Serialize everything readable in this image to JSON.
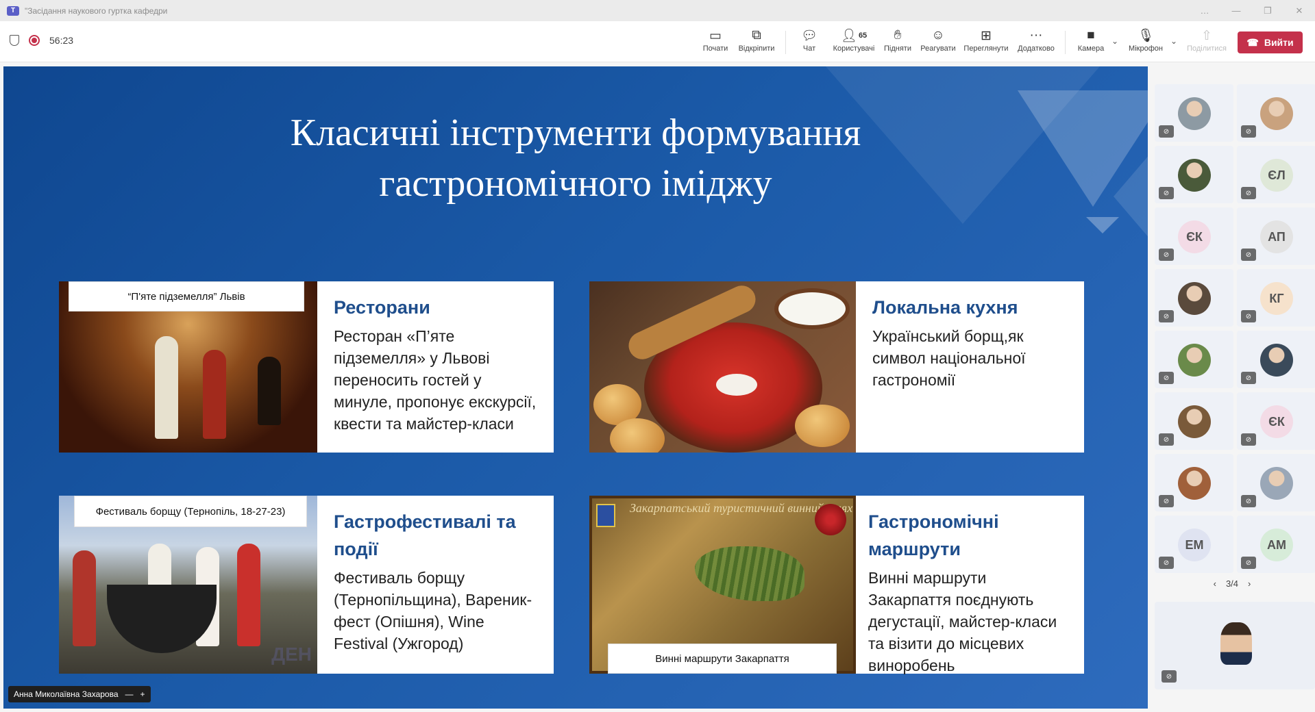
{
  "window": {
    "title": "\"Засідання наукового гуртка кафедри",
    "controls": [
      "…",
      "—",
      "❐",
      "✕"
    ]
  },
  "meeting": {
    "timer": "56:23"
  },
  "toolbar": {
    "start": "Почати",
    "popout": "Відкріпити",
    "chat": "Чат",
    "people": "Користувачі",
    "people_count": "65",
    "raise": "Підняти",
    "react": "Реагувати",
    "view": "Переглянути",
    "more": "Додатково",
    "camera": "Камера",
    "mic": "Мікрофон",
    "share": "Поділитися",
    "leave": "Вийти"
  },
  "slide": {
    "title": "Класичні інструменти формування гастрономічного іміджу",
    "cards": [
      {
        "caption": "“П'яте підземелля” Львів",
        "heading": "Ресторани",
        "body": "Ресторан «П’яте підземелля» у Львові переносить гостей у минуле,  пропонує екскурсії, квести та майстер-класи"
      },
      {
        "caption": "",
        "heading": "Локальна кухня",
        "body": "Український борщ,як символ національної гастрономії"
      },
      {
        "caption": "Фестиваль борщу (Тернопіль, 18-27-23)",
        "heading": "Гастрофестивалі та події",
        "body": "Фестиваль борщу (Тернопільщина), Вареник-фест (Опішня), Wine Festival (Ужгород)",
        "watermark": "ДЕН"
      },
      {
        "caption": "Винні маршрути Закарпаття",
        "heading": "Гастрономічні маршрути",
        "body": "Винні маршрути Закарпаття поєднують дегустації, майстер-класи та візити до місцевих виноробень",
        "map_title": "Закарпатський туристичний винний шлях"
      }
    ]
  },
  "participants": [
    {
      "initials": "",
      "kind": "photo",
      "color": "#8d9aa3"
    },
    {
      "initials": "",
      "kind": "photo",
      "color": "#c9a27e"
    },
    {
      "initials": "",
      "kind": "photo",
      "color": "#4a5a3a"
    },
    {
      "initials": "ЄЛ",
      "kind": "initials",
      "color": "#dfe8d8"
    },
    {
      "initials": "ЄК",
      "kind": "initials",
      "color": "#f3dbe6"
    },
    {
      "initials": "АП",
      "kind": "initials",
      "color": "#e3e3e3"
    },
    {
      "initials": "",
      "kind": "photo",
      "color": "#5a4a3c"
    },
    {
      "initials": "КГ",
      "kind": "initials",
      "color": "#f6e2cc"
    },
    {
      "initials": "",
      "kind": "photo",
      "color": "#6a8a4a"
    },
    {
      "initials": "",
      "kind": "photo",
      "color": "#3a4a5a"
    },
    {
      "initials": "",
      "kind": "photo",
      "color": "#7a5a3a"
    },
    {
      "initials": "ЄК",
      "kind": "initials",
      "color": "#f3dbe6"
    },
    {
      "initials": "",
      "kind": "photo",
      "color": "#a0603a"
    },
    {
      "initials": "",
      "kind": "photo",
      "color": "#9aa7b7"
    },
    {
      "initials": "ЕМ",
      "kind": "initials",
      "color": "#dfe3f1"
    },
    {
      "initials": "АМ",
      "kind": "initials",
      "color": "#d7ecd9"
    }
  ],
  "pager": {
    "label": "3/4"
  },
  "presenter": {
    "name": "Анна Миколаївна Захарова"
  }
}
